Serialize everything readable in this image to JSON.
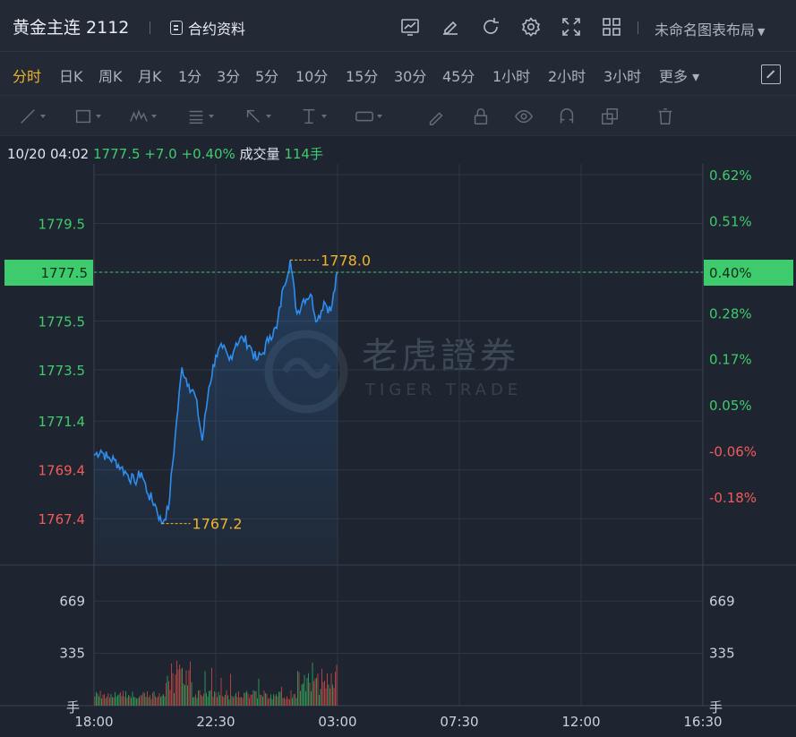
{
  "header": {
    "title": "黄金主连 2112",
    "contract_label": "合约资料",
    "layout_label": "未命名图表布局",
    "icons": [
      "chart-settings-icon",
      "edit-icon",
      "refresh-icon",
      "gear-icon",
      "fullscreen-icon",
      "grid-icon"
    ]
  },
  "periods": {
    "items": [
      "分时",
      "日K",
      "周K",
      "月K",
      "1分",
      "3分",
      "5分",
      "10分",
      "15分",
      "30分",
      "45分",
      "1小时",
      "2小时",
      "3小时",
      "更多 ▾"
    ],
    "active": "分时"
  },
  "info": {
    "datetime": "10/20 04:02",
    "price": "1777.5",
    "change": "+7.0",
    "change_pct": "+0.40%",
    "volume_label": "成交量",
    "volume": "114手"
  },
  "watermark": {
    "cn": "老虎證券",
    "en": "TIGER TRADE"
  },
  "colors": {
    "line": "#2f8df0",
    "up": "#3ecb6d",
    "down": "#f05b5b",
    "marker": "#f0b429",
    "background": "#1f2530"
  },
  "chart_data": {
    "type": "line",
    "price_series": {
      "x": [
        "18:00",
        "18:15",
        "18:30",
        "18:45",
        "19:00",
        "19:15",
        "19:30",
        "19:45",
        "20:00",
        "20:15",
        "20:30",
        "20:45",
        "21:00",
        "21:15",
        "21:30",
        "21:45",
        "22:00",
        "22:15",
        "22:30",
        "22:45",
        "23:00",
        "23:15",
        "23:30",
        "23:45",
        "00:00",
        "00:15",
        "00:30",
        "00:45",
        "01:00",
        "01:15",
        "01:30",
        "01:45",
        "02:00",
        "02:15",
        "02:30",
        "02:45",
        "03:00",
        "03:15",
        "03:30",
        "03:45",
        "04:00",
        "04:02"
      ],
      "y": [
        1770.0,
        1770.2,
        1769.9,
        1769.8,
        1769.5,
        1769.2,
        1768.9,
        1769.3,
        1768.4,
        1768.0,
        1767.2,
        1767.8,
        1770.8,
        1773.6,
        1772.9,
        1772.4,
        1770.6,
        1772.8,
        1774.1,
        1774.4,
        1773.9,
        1774.6,
        1774.8,
        1774.5,
        1773.9,
        1774.2,
        1774.9,
        1775.2,
        1776.9,
        1778.0,
        1775.8,
        1776.4,
        1776.6,
        1775.5,
        1776.3,
        1775.9,
        1777.5
      ]
    },
    "reference_price": 1770.5,
    "current_price": "1777.5",
    "high": {
      "label": "1778.0",
      "value": 1778.0
    },
    "low": {
      "label": "1767.2",
      "value": 1767.2
    },
    "y_ticks_left": [
      "1779.5",
      "1777.5",
      "1775.5",
      "1773.5",
      "1771.4",
      "1769.4",
      "1767.4"
    ],
    "y_ticks_right": [
      "0.62%",
      "0.51%",
      "0.40%",
      "0.28%",
      "0.17%",
      "0.05%",
      "-0.06%",
      "-0.18%"
    ],
    "x_ticks": [
      "18:00",
      "22:30",
      "03:00",
      "07:30",
      "12:00",
      "16:30"
    ],
    "volume_ticks": [
      "669",
      "335"
    ],
    "volume_unit": "手",
    "ylim": [
      1765.5,
      1781.5
    ],
    "volume_max": 900
  }
}
